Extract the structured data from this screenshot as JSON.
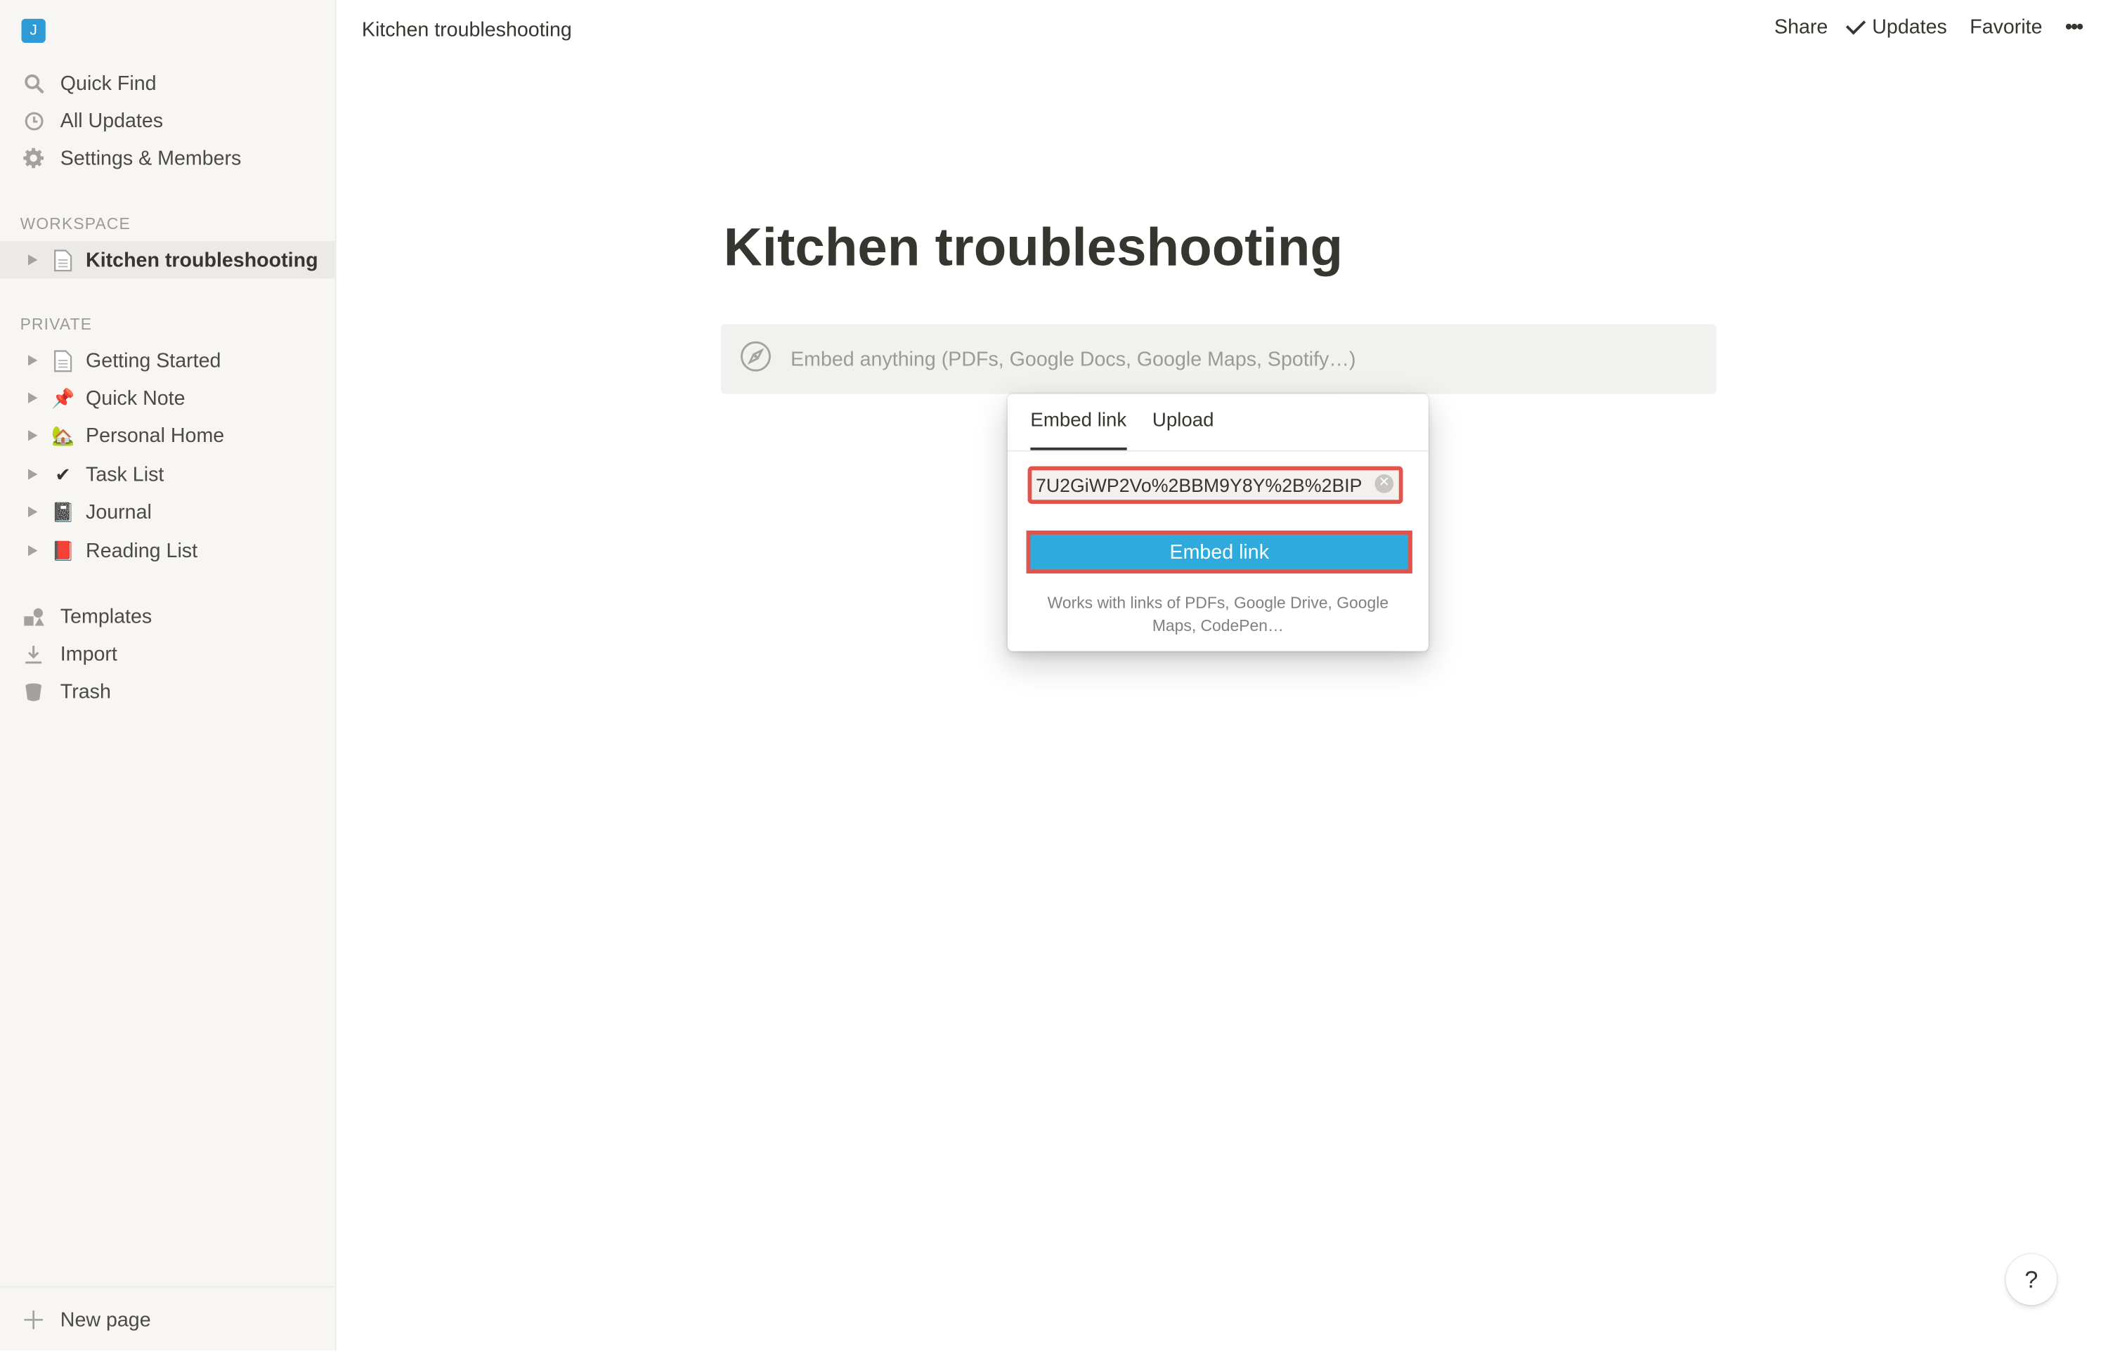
{
  "workspace": {
    "initial": "J"
  },
  "sidebar": {
    "nav": [
      {
        "label": "Quick Find",
        "icon": "search-icon"
      },
      {
        "label": "All Updates",
        "icon": "clock-icon"
      },
      {
        "label": "Settings & Members",
        "icon": "gear-icon"
      }
    ],
    "workspace_header": "WORKSPACE",
    "workspace_pages": [
      {
        "label": "Kitchen troubleshooting",
        "icon": "page-icon"
      }
    ],
    "private_header": "PRIVATE",
    "private_pages": [
      {
        "label": "Getting Started",
        "icon": "page-icon"
      },
      {
        "label": "Quick Note",
        "icon": "pushpin-icon",
        "emoji": "📌"
      },
      {
        "label": "Personal Home",
        "icon": "house-icon",
        "emoji": "🏡"
      },
      {
        "label": "Task List",
        "icon": "checkmark-icon",
        "emoji": "✔"
      },
      {
        "label": "Journal",
        "icon": "notebook-icon",
        "emoji": "📓"
      },
      {
        "label": "Reading List",
        "icon": "book-icon",
        "emoji": "📕"
      }
    ],
    "tools": [
      {
        "label": "Templates",
        "icon": "templates-icon"
      },
      {
        "label": "Import",
        "icon": "import-icon"
      },
      {
        "label": "Trash",
        "icon": "trash-icon"
      }
    ],
    "new_page": "New page"
  },
  "topbar": {
    "breadcrumb": "Kitchen troubleshooting",
    "share": "Share",
    "updates": "Updates",
    "favorite": "Favorite",
    "more": "•••"
  },
  "page": {
    "title": "Kitchen troubleshooting",
    "embed_placeholder": "Embed anything (PDFs, Google Docs, Google Maps, Spotify…)"
  },
  "embed_popup": {
    "tabs": [
      "Embed link",
      "Upload"
    ],
    "active_tab": "Embed link",
    "url_value": "7U2GiWP2Vo%2BBM9Y8Y%2B%2BIP",
    "button": "Embed link",
    "hint": "Works with links of PDFs, Google Drive, Google Maps, CodePen…"
  },
  "help": "?",
  "colors": {
    "accent": "#2eaadc",
    "highlight": "#e5524a",
    "sidebar_bg": "#f7f6f3"
  }
}
